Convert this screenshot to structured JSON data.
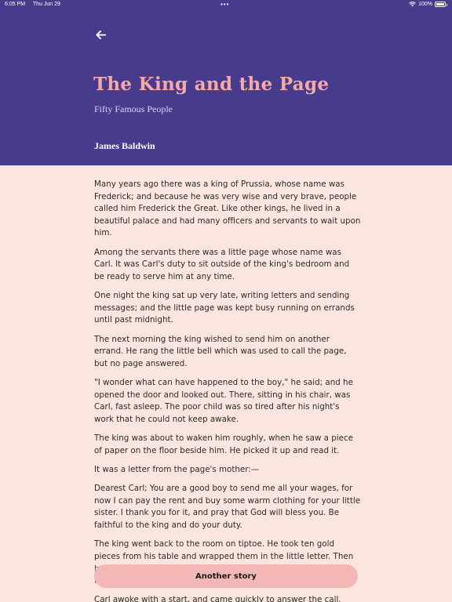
{
  "status_bar": {
    "time": "6:05 PM",
    "date": "Thu Jun 29",
    "dots": "•••",
    "battery": "100%"
  },
  "header": {
    "back_icon": "arrow-left-icon",
    "title": "The King and the Page",
    "subtitle": "Fifty Famous People",
    "author": "James Baldwin"
  },
  "story": {
    "paragraphs": [
      "Many years ago there was a king of Prussia, whose name was Frederick; and because he was very wise and very brave, people called him Frederick the Great. Like other kings, he lived in a beautiful palace and had many officers and servants to wait upon him.",
      "Among the servants there was a little page whose name was Carl. It was Carl's duty to sit outside of the king's bedroom and be ready to serve him at any time.",
      "One night the king sat up very late, writing letters and sending messages; and the little page was kept busy running on errands until past midnight.",
      "The next morning the king wished to send him on another errand. He rang the little bell which was used to call the page, but no page answered.",
      "\"I wonder what can have happened to the boy,\" he said; and he opened the door and looked out. There, sitting in his chair, was Carl, fast asleep. The poor child was so tired after his night's work that he could not keep awake.",
      "The king was about to waken him roughly, when he saw a piece of paper on the floor beside him. He picked it up and read it.",
      "It was a letter from the page's mother:—",
      "Dearest Carl; You are a good boy to send me all your wages, for now I can pay the rent and buy some warm clothing for your little sister. I thank you for it, and pray that God will bless you. Be faithful to the king and do your duty.",
      "The king went back to the room on tiptoe. He took ten gold pieces from his table and wrapped them in the little letter. Then he went out again, very quietly, and slipped them all into the boy's pocket.",
      "Carl awoke with a start, and came quickly to answer the call."
    ]
  },
  "actions": {
    "another_story": "Another story"
  },
  "colors": {
    "header_bg": "#473C8C",
    "page_bg": "#FBE6DF",
    "title": "#F7A9A3",
    "button_bg": "#F3B8B5"
  }
}
